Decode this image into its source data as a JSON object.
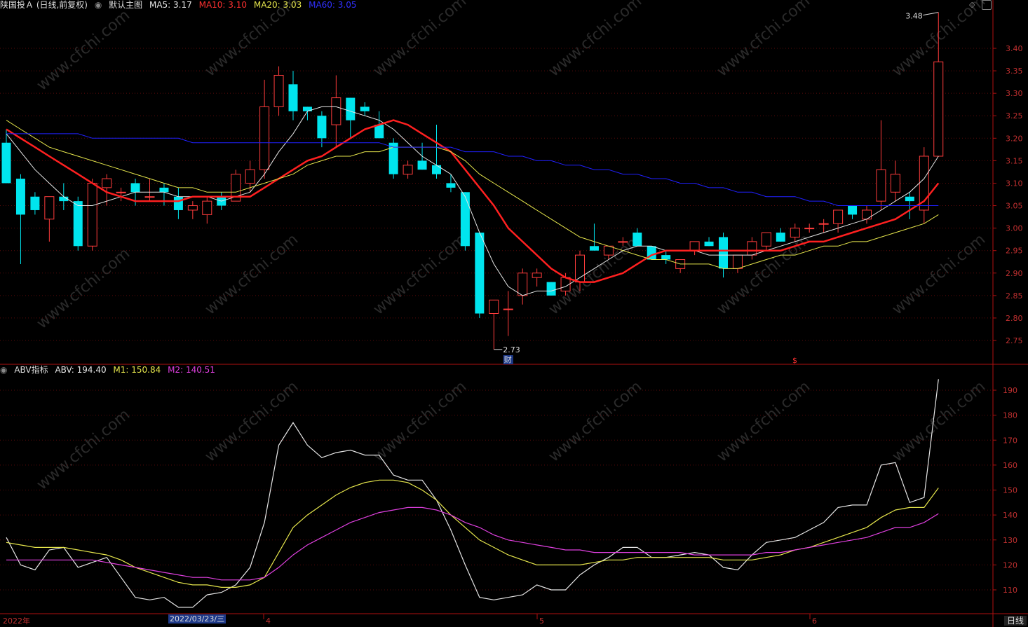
{
  "header": {
    "title": "陕国投Ａ (日线,前复权)",
    "main_chart_label": "默认主图",
    "ma_items": [
      {
        "label": "MA5: 3.17",
        "color": "#e6e6e6"
      },
      {
        "label": "MA10: 3.10",
        "color": "#ff3030"
      },
      {
        "label": "MA20: 3.03",
        "color": "#e6e64c"
      },
      {
        "label": "MA60: 3.05",
        "color": "#3030ff"
      }
    ]
  },
  "indicator": {
    "name": "ABV指标",
    "items": [
      {
        "label": "ABV: 194.40",
        "color": "#e6e6e6"
      },
      {
        "label": "M1: 150.84",
        "color": "#e6e64c"
      },
      {
        "label": "M2: 140.51",
        "color": "#e040e0"
      }
    ]
  },
  "annotations": {
    "high_label": "3.48",
    "low_label": "2.73",
    "cai_marker": "财",
    "dollar_marker": "$"
  },
  "footer": {
    "year_label": "2022年",
    "cursor_date": "2022/03/23/三",
    "months": [
      "4",
      "5",
      "6"
    ],
    "period_label": "日线"
  },
  "watermark": "www.cfchi.com",
  "colors": {
    "up": "#ff3c3c",
    "down": "#00e5ee",
    "axis": "#b01010",
    "grid": "#5a0a0a"
  },
  "chart_data": [
    {
      "type": "candlestick",
      "ylim": [
        2.7,
        3.48
      ],
      "yticks": [
        2.75,
        2.8,
        2.85,
        2.9,
        2.95,
        3.0,
        3.05,
        3.1,
        3.15,
        3.2,
        3.25,
        3.3,
        3.35,
        3.4
      ],
      "candles": [
        [
          3.19,
          3.22,
          3.1,
          3.1
        ],
        [
          3.11,
          3.12,
          2.92,
          3.03
        ],
        [
          3.07,
          3.08,
          3.03,
          3.04
        ],
        [
          3.02,
          3.07,
          2.97,
          3.07
        ],
        [
          3.07,
          3.1,
          3.04,
          3.06
        ],
        [
          3.06,
          3.07,
          2.95,
          2.96
        ],
        [
          2.96,
          3.11,
          2.95,
          3.1
        ],
        [
          3.09,
          3.12,
          3.05,
          3.11
        ],
        [
          3.08,
          3.09,
          3.06,
          3.08
        ],
        [
          3.1,
          3.11,
          3.05,
          3.08
        ],
        [
          3.07,
          3.11,
          3.06,
          3.07
        ],
        [
          3.09,
          3.1,
          3.05,
          3.08
        ],
        [
          3.07,
          3.09,
          3.02,
          3.04
        ],
        [
          3.04,
          3.06,
          3.02,
          3.05
        ],
        [
          3.03,
          3.07,
          3.01,
          3.06
        ],
        [
          3.07,
          3.08,
          3.04,
          3.05
        ],
        [
          3.06,
          3.13,
          3.06,
          3.12
        ],
        [
          3.1,
          3.15,
          3.08,
          3.13
        ],
        [
          3.13,
          3.33,
          3.11,
          3.27
        ],
        [
          3.27,
          3.36,
          3.25,
          3.34
        ],
        [
          3.32,
          3.35,
          3.24,
          3.26
        ],
        [
          3.27,
          3.27,
          3.24,
          3.26
        ],
        [
          3.25,
          3.26,
          3.18,
          3.2
        ],
        [
          3.23,
          3.34,
          3.18,
          3.29
        ],
        [
          3.29,
          3.29,
          3.2,
          3.24
        ],
        [
          3.27,
          3.28,
          3.25,
          3.26
        ],
        [
          3.23,
          3.26,
          3.2,
          3.2
        ],
        [
          3.19,
          3.2,
          3.11,
          3.12
        ],
        [
          3.12,
          3.15,
          3.11,
          3.14
        ],
        [
          3.15,
          3.19,
          3.13,
          3.13
        ],
        [
          3.14,
          3.23,
          3.11,
          3.12
        ],
        [
          3.1,
          3.12,
          3.08,
          3.09
        ],
        [
          3.08,
          3.08,
          2.95,
          2.96
        ],
        [
          2.99,
          2.99,
          2.8,
          2.81
        ],
        [
          2.81,
          2.84,
          2.73,
          2.84
        ],
        [
          2.82,
          2.86,
          2.76,
          2.82
        ],
        [
          2.85,
          2.91,
          2.83,
          2.9
        ],
        [
          2.89,
          2.91,
          2.87,
          2.9
        ],
        [
          2.88,
          2.88,
          2.85,
          2.85
        ],
        [
          2.86,
          2.9,
          2.85,
          2.89
        ],
        [
          2.88,
          2.95,
          2.86,
          2.94
        ],
        [
          2.96,
          3.01,
          2.95,
          2.95
        ],
        [
          2.94,
          2.96,
          2.93,
          2.96
        ],
        [
          2.97,
          2.98,
          2.96,
          2.97
        ],
        [
          2.99,
          3.0,
          2.96,
          2.96
        ],
        [
          2.96,
          2.96,
          2.93,
          2.93
        ],
        [
          2.94,
          2.95,
          2.92,
          2.93
        ],
        [
          2.91,
          2.93,
          2.9,
          2.93
        ],
        [
          2.95,
          2.97,
          2.94,
          2.97
        ],
        [
          2.97,
          2.98,
          2.96,
          2.96
        ],
        [
          2.98,
          2.99,
          2.89,
          2.91
        ],
        [
          2.91,
          2.93,
          2.9,
          2.94
        ],
        [
          2.94,
          2.98,
          2.93,
          2.97
        ],
        [
          2.96,
          2.99,
          2.95,
          2.99
        ],
        [
          2.99,
          3.0,
          2.97,
          2.97
        ],
        [
          2.98,
          3.01,
          2.97,
          3.0
        ],
        [
          3.0,
          3.01,
          2.99,
          3.0
        ],
        [
          3.01,
          3.02,
          2.99,
          3.01
        ],
        [
          3.01,
          3.04,
          2.99,
          3.04
        ],
        [
          3.05,
          3.05,
          3.02,
          3.03
        ],
        [
          3.02,
          3.05,
          3.01,
          3.04
        ],
        [
          3.06,
          3.24,
          3.04,
          3.13
        ],
        [
          3.08,
          3.15,
          3.06,
          3.12
        ],
        [
          3.07,
          3.08,
          3.02,
          3.06
        ],
        [
          3.04,
          3.18,
          3.01,
          3.16
        ],
        [
          3.16,
          3.48,
          3.16,
          3.37
        ]
      ],
      "ma_series": [
        {
          "name": "MA5",
          "values": [
            3.21,
            3.17,
            3.13,
            3.1,
            3.07,
            3.05,
            3.05,
            3.06,
            3.07,
            3.08,
            3.08,
            3.08,
            3.07,
            3.07,
            3.07,
            3.06,
            3.07,
            3.08,
            3.12,
            3.17,
            3.21,
            3.26,
            3.27,
            3.27,
            3.26,
            3.25,
            3.24,
            3.22,
            3.19,
            3.16,
            3.14,
            3.12,
            3.07,
            2.99,
            2.92,
            2.87,
            2.85,
            2.86,
            2.86,
            2.87,
            2.89,
            2.91,
            2.93,
            2.95,
            2.96,
            2.96,
            2.95,
            2.95,
            2.95,
            2.94,
            2.94,
            2.94,
            2.94,
            2.95,
            2.96,
            2.97,
            2.98,
            2.99,
            3.0,
            3.01,
            3.02,
            3.04,
            3.06,
            3.08,
            3.11,
            3.16
          ]
        },
        {
          "name": "MA10",
          "values": [
            3.22,
            3.2,
            3.18,
            3.16,
            3.14,
            3.12,
            3.1,
            3.08,
            3.07,
            3.06,
            3.06,
            3.06,
            3.06,
            3.07,
            3.07,
            3.07,
            3.07,
            3.07,
            3.09,
            3.11,
            3.13,
            3.15,
            3.16,
            3.18,
            3.2,
            3.22,
            3.23,
            3.24,
            3.23,
            3.21,
            3.19,
            3.17,
            3.13,
            3.09,
            3.05,
            3.0,
            2.97,
            2.94,
            2.91,
            2.89,
            2.88,
            2.88,
            2.89,
            2.9,
            2.92,
            2.94,
            2.95,
            2.95,
            2.95,
            2.95,
            2.95,
            2.95,
            2.95,
            2.95,
            2.95,
            2.96,
            2.97,
            2.97,
            2.98,
            2.99,
            3.0,
            3.01,
            3.02,
            3.04,
            3.06,
            3.1
          ]
        },
        {
          "name": "MA20",
          "values": [
            3.24,
            3.22,
            3.2,
            3.18,
            3.17,
            3.16,
            3.15,
            3.14,
            3.13,
            3.12,
            3.11,
            3.1,
            3.09,
            3.09,
            3.08,
            3.08,
            3.08,
            3.09,
            3.1,
            3.11,
            3.12,
            3.14,
            3.15,
            3.16,
            3.16,
            3.17,
            3.17,
            3.18,
            3.18,
            3.18,
            3.18,
            3.17,
            3.15,
            3.12,
            3.1,
            3.08,
            3.06,
            3.04,
            3.02,
            3.0,
            2.98,
            2.97,
            2.96,
            2.95,
            2.94,
            2.93,
            2.93,
            2.92,
            2.92,
            2.92,
            2.91,
            2.91,
            2.92,
            2.93,
            2.94,
            2.94,
            2.95,
            2.96,
            2.96,
            2.97,
            2.97,
            2.98,
            2.99,
            3.0,
            3.01,
            3.03
          ]
        },
        {
          "name": "MA60",
          "values": [
            3.21,
            3.21,
            3.21,
            3.21,
            3.21,
            3.21,
            3.2,
            3.2,
            3.2,
            3.2,
            3.2,
            3.2,
            3.2,
            3.19,
            3.19,
            3.19,
            3.19,
            3.19,
            3.19,
            3.19,
            3.19,
            3.19,
            3.19,
            3.19,
            3.19,
            3.19,
            3.19,
            3.18,
            3.18,
            3.18,
            3.18,
            3.18,
            3.17,
            3.17,
            3.17,
            3.16,
            3.16,
            3.15,
            3.15,
            3.14,
            3.14,
            3.13,
            3.13,
            3.12,
            3.12,
            3.11,
            3.11,
            3.1,
            3.1,
            3.09,
            3.09,
            3.08,
            3.08,
            3.07,
            3.07,
            3.07,
            3.06,
            3.06,
            3.05,
            3.05,
            3.05,
            3.05,
            3.05,
            3.05,
            3.05,
            3.05
          ]
        }
      ]
    },
    {
      "type": "line",
      "ylim": [
        103,
        196
      ],
      "yticks": [
        110,
        120,
        130,
        140,
        150,
        160,
        170,
        180,
        190
      ],
      "series": [
        {
          "name": "ABV",
          "values": [
            131,
            120,
            118,
            126,
            127,
            119,
            121,
            123,
            115,
            107,
            106,
            107,
            103,
            103,
            108,
            109,
            112,
            119,
            137,
            168,
            177,
            168,
            163,
            165,
            166,
            164,
            164,
            156,
            154,
            154,
            146,
            134,
            120,
            107,
            106,
            107,
            108,
            112,
            110,
            110,
            116,
            120,
            123,
            127,
            127,
            123,
            123,
            124,
            125,
            124,
            119,
            118,
            124,
            129,
            130,
            131,
            134,
            137,
            143,
            144,
            144,
            160,
            161,
            145,
            147,
            194.4
          ]
        },
        {
          "name": "M1",
          "values": [
            129,
            128,
            127,
            127,
            127,
            126,
            125,
            124,
            122,
            119,
            117,
            115,
            113,
            112,
            112,
            111,
            111,
            112,
            115,
            125,
            135,
            140,
            144,
            148,
            151,
            153,
            154,
            154,
            153,
            150,
            146,
            140,
            135,
            130,
            127,
            124,
            122,
            120,
            120,
            120,
            120,
            121,
            122,
            122,
            123,
            123,
            123,
            123,
            123,
            123,
            122,
            122,
            122,
            123,
            124,
            126,
            127,
            129,
            131,
            133,
            135,
            139,
            142,
            143,
            143,
            150.84
          ]
        },
        {
          "name": "M2",
          "values": [
            122,
            122,
            122,
            122,
            122,
            122,
            122,
            121,
            120,
            119,
            118,
            117,
            116,
            115,
            115,
            114,
            114,
            114,
            115,
            119,
            124,
            128,
            131,
            134,
            137,
            139,
            141,
            142,
            143,
            143,
            142,
            140,
            137,
            135,
            132,
            130,
            129,
            128,
            127,
            126,
            126,
            125,
            125,
            125,
            125,
            125,
            125,
            125,
            124,
            124,
            124,
            124,
            124,
            125,
            125,
            126,
            127,
            128,
            129,
            130,
            131,
            133,
            135,
            135,
            137,
            140.51
          ]
        }
      ]
    }
  ]
}
